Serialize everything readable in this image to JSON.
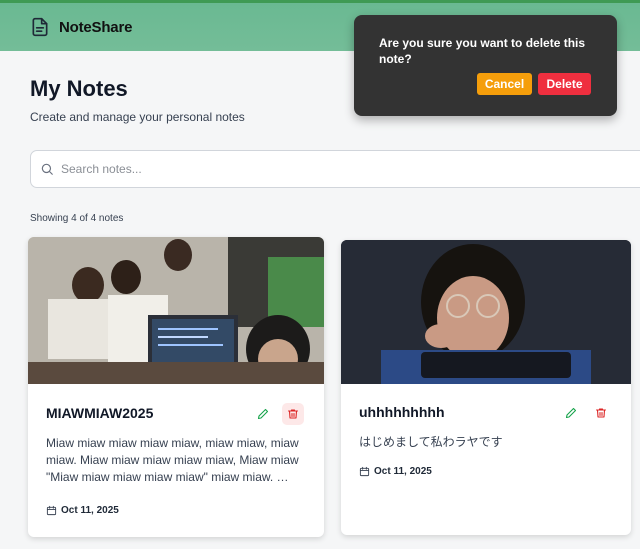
{
  "header": {
    "brand_name": "NoteShare",
    "brand_icon": "document-icon"
  },
  "page": {
    "title": "My Notes",
    "subtitle": "Create and manage your personal notes"
  },
  "search": {
    "placeholder": "Search notes...",
    "value": ""
  },
  "count_text": "Showing 4 of 4 notes",
  "notes": [
    {
      "title": "MIAWMIAW2025",
      "body": "Miaw miaw miaw miaw miaw, miaw miaw, miaw miaw. Miaw miaw miaw miaw miaw, Miaw miaw \"Miaw miaw miaw miaw miaw\" miaw miaw. …",
      "date": "Oct 11, 2025"
    },
    {
      "title": "uhhhhhhhhh",
      "body": "はじめまして私わラヤです",
      "date": "Oct 11, 2025"
    }
  ],
  "confirm_dialog": {
    "message": "Are you sure you want to delete this note?",
    "cancel_label": "Cancel",
    "delete_label": "Delete"
  },
  "colors": {
    "header": "#6ab992",
    "cancel": "#f59e0b",
    "delete": "#ef2f3f",
    "edit_icon": "#16a34a",
    "delete_icon": "#dc2626"
  }
}
